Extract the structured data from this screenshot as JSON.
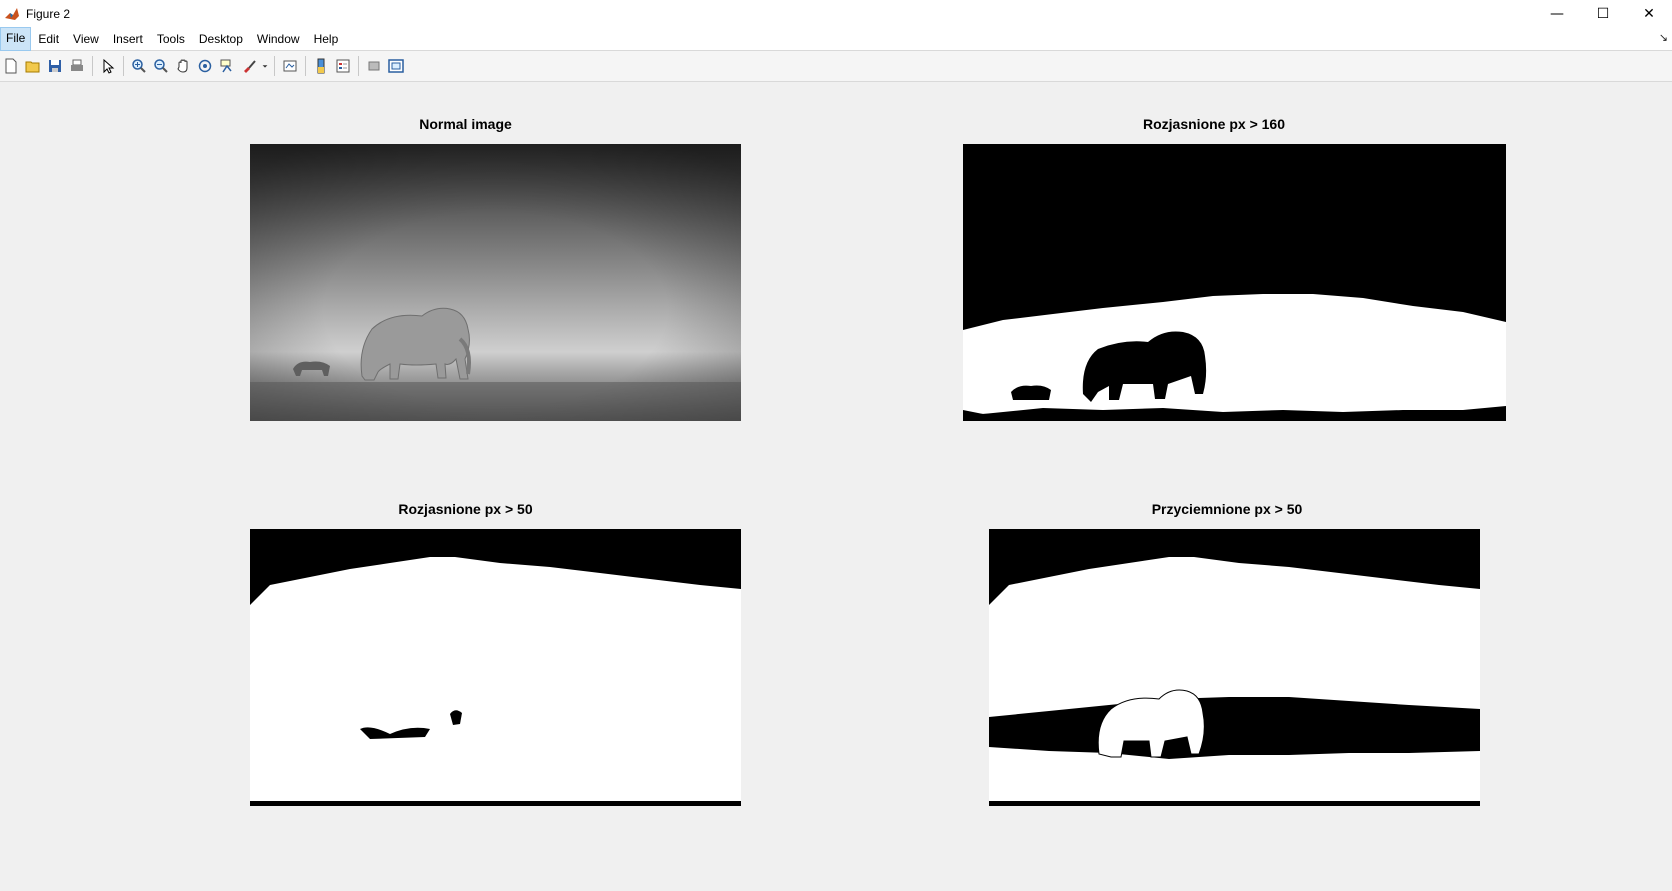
{
  "window": {
    "title": "Figure 2",
    "controls": {
      "minimize": "—",
      "maximize": "☐",
      "close": "✕"
    }
  },
  "menubar": {
    "items": [
      "File",
      "Edit",
      "View",
      "Insert",
      "Tools",
      "Desktop",
      "Window",
      "Help"
    ]
  },
  "toolbar": {
    "buttons": [
      "new-figure-icon",
      "open-file-icon",
      "save-icon",
      "print-icon",
      "edit-plot-arrow-icon",
      "zoom-in-icon",
      "zoom-out-icon",
      "pan-hand-icon",
      "rotate-3d-icon",
      "data-cursor-icon",
      "brush-icon",
      "link-plot-icon",
      "insert-colorbar-icon",
      "insert-legend-icon",
      "hide-plot-tools-icon",
      "show-plot-tools-icon"
    ]
  },
  "subplots": [
    {
      "title": "Normal image"
    },
    {
      "title": "Rozjasnione px > 160"
    },
    {
      "title": "Rozjasnione px > 50"
    },
    {
      "title": "Przyciemnione px > 50"
    }
  ],
  "colors": {
    "figure_background": "#f0f0f0",
    "mask_white": "#ffffff",
    "mask_black": "#000000"
  }
}
